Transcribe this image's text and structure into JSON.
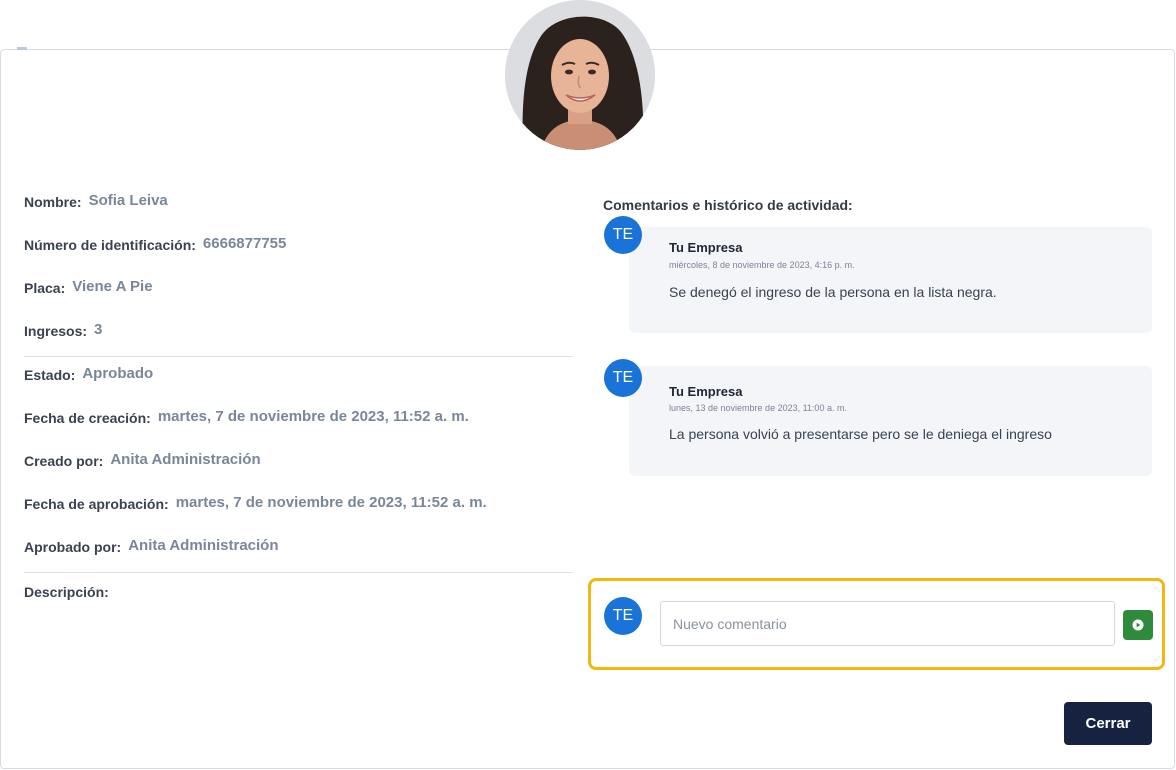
{
  "profile": {
    "fields": {
      "nombre": {
        "label": "Nombre:",
        "value": "Sofia Leiva"
      },
      "identificacion": {
        "label": "Número de identificación:",
        "value": "6666877755"
      },
      "placa": {
        "label": "Placa:",
        "value": "Viene A Pie"
      },
      "ingresos": {
        "label": "Ingresos:",
        "value": "3"
      },
      "estado": {
        "label": "Estado:",
        "value": "Aprobado"
      },
      "fecha_creacion": {
        "label": "Fecha de creación:",
        "value": "martes, 7 de noviembre de 2023, 11:52 a. m."
      },
      "creado_por": {
        "label": "Creado por:",
        "value": "Anita Administración"
      },
      "fecha_aprobacion": {
        "label": "Fecha de aprobación:",
        "value": "martes, 7 de noviembre de 2023, 11:52 a. m."
      },
      "aprobado_por": {
        "label": "Aprobado por:",
        "value": "Anita Administración"
      },
      "descripcion": {
        "label": "Descripción:",
        "value": ""
      }
    }
  },
  "activity": {
    "title": "Comentarios e histórico de actividad:",
    "comments": [
      {
        "initials": "TE",
        "author": "Tu Empresa",
        "date": "miércoles, 8 de noviembre de 2023, 4:16 p. m.",
        "text": "Se denegó el ingreso de la persona en la lista negra."
      },
      {
        "initials": "TE",
        "author": "Tu Empresa",
        "date": "lunes, 13 de noviembre de 2023, 11:00 a. m.",
        "text": "La persona volvió a presentarse pero se le deniega el ingreso"
      }
    ],
    "new_comment": {
      "initials": "TE",
      "placeholder": "Nuevo comentario",
      "send_icon": "play-circle-icon"
    }
  },
  "footer": {
    "close_label": "Cerrar"
  },
  "colors": {
    "accent_blue": "#1a73d8",
    "highlight": "#f1b712",
    "send_green": "#2e8b3c",
    "close_navy": "#172240"
  }
}
